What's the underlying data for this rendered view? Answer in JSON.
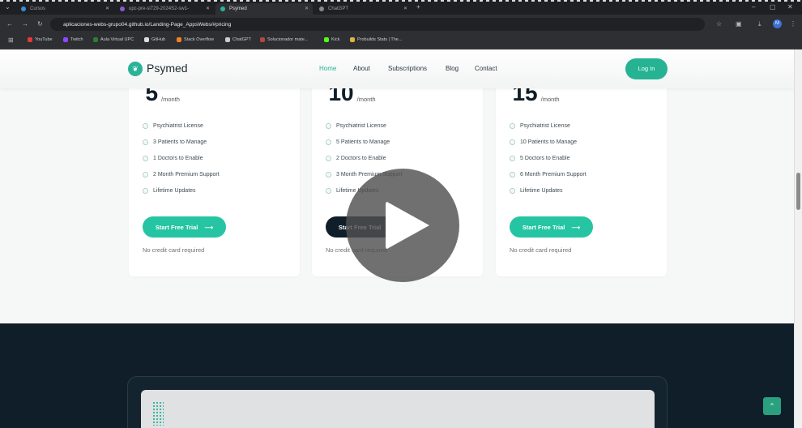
{
  "browser": {
    "tabs": [
      {
        "label": "Cursos",
        "color": "#3a8fd8",
        "active": false
      },
      {
        "label": "upc-pre-si729-2024S2-sw1-",
        "color": "#8a5ad6",
        "active": false
      },
      {
        "label": "Psymed",
        "color": "#2bb39a",
        "active": true
      },
      {
        "label": "ChatGPT",
        "color": "#888888",
        "active": false
      }
    ],
    "url": "aplicaciones-webs-grupo04.github.io/Landing-Page_AppsWebs/#pricing",
    "bookmarks": [
      {
        "label": "YouTube",
        "color": "#e53935"
      },
      {
        "label": "Twitch",
        "color": "#9146ff"
      },
      {
        "label": "Aula Virtual UPC",
        "color": "#2e7d32"
      },
      {
        "label": "GitHub",
        "color": "#dddddd"
      },
      {
        "label": "Stack Overflow",
        "color": "#f48024"
      },
      {
        "label": "ChatGPT",
        "color": "#cccccc"
      },
      {
        "label": "Solucionador mate...",
        "color": "#b04a3a"
      },
      {
        "label": "Kick",
        "color": "#53fc18"
      },
      {
        "label": "Probuilds Stats | The...",
        "color": "#d8b441"
      }
    ]
  },
  "nav": {
    "brand": "Psymed",
    "links": [
      "Home",
      "About",
      "Subscriptions",
      "Blog",
      "Contact"
    ],
    "login": "Log In"
  },
  "plans": [
    {
      "currency": "$",
      "price": "5",
      "period": "/month",
      "features": [
        "Psychiatrist License",
        "3 Patients to Manage",
        "1 Doctors to Enable",
        "2 Month Premium Support",
        "Lifetime Updates"
      ],
      "cta": "Start Free Trial",
      "note": "No credit card required",
      "dark": false
    },
    {
      "currency": "$",
      "price": "10",
      "period": "/month",
      "features": [
        "Psychiatrist License",
        "5 Patients to Manage",
        "2 Doctors to Enable",
        "3 Month Premium Support",
        "Lifetime Updates"
      ],
      "cta": "Start Free Trial",
      "note": "No credit card required",
      "dark": true
    },
    {
      "currency": "$",
      "price": "15",
      "period": "/month",
      "features": [
        "Psychiatrist License",
        "10 Patients to Manage",
        "5 Doctors to Enable",
        "6 Month Premium Support",
        "Lifetime Updates"
      ],
      "cta": "Start Free Trial",
      "note": "No credit card required",
      "dark": false
    }
  ],
  "colors": {
    "accent": "#25b393",
    "dark": "#0f1e28"
  },
  "icons": {
    "play": "play-icon",
    "scroll_top": "arrow-up-icon"
  }
}
